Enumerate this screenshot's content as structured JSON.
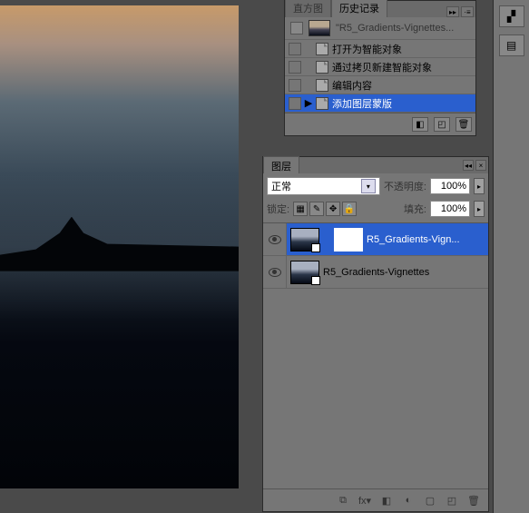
{
  "history": {
    "tabs": {
      "histogram": "直方图",
      "history": "历史记录"
    },
    "snapshot": "\"R5_Gradients-Vignettes...",
    "items": [
      {
        "label": "打开为智能对象"
      },
      {
        "label": "通过拷贝新建智能对象"
      },
      {
        "label": "编辑内容"
      },
      {
        "label": "添加图层蒙版",
        "selected": true
      }
    ]
  },
  "layers": {
    "title": "图层",
    "blend": {
      "value": "正常"
    },
    "opacity": {
      "label": "不透明度:",
      "value": "100%"
    },
    "lock": {
      "label": "锁定:"
    },
    "fill": {
      "label": "填充:",
      "value": "100%"
    },
    "items": [
      {
        "name": "R5_Gradients-Vign...",
        "hasMask": true,
        "selected": true
      },
      {
        "name": "R5_Gradients-Vignettes",
        "hasMask": false,
        "selected": false
      }
    ]
  }
}
